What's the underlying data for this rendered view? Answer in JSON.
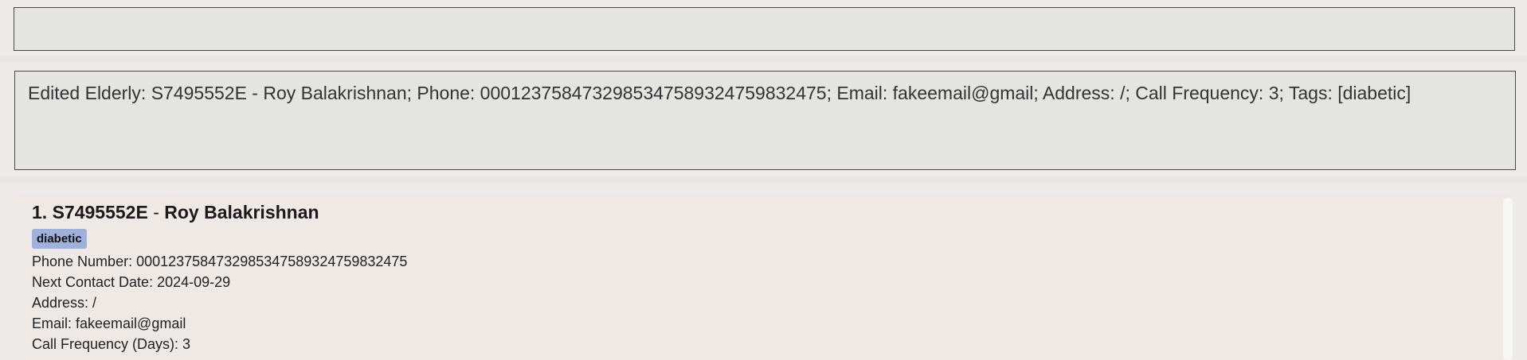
{
  "command_box": {
    "value": "",
    "placeholder": ""
  },
  "result_display": {
    "message": "Edited Elderly: S7495552E - Roy Balakrishnan; Phone: 0001237584732985347589324759832475; Email: fakeemail@gmail; Address: /; Call Frequency: 3; Tags: [diabetic]"
  },
  "person_list": {
    "cards": [
      {
        "index": "1.",
        "nric": "S7495552E",
        "separator": "-",
        "name": "Roy Balakrishnan",
        "tags": [
          "diabetic"
        ],
        "phone": "Phone Number: 0001237584732985347589324759832475",
        "next_contact": "Next Contact Date: 2024-09-29",
        "address": "Address: /",
        "email": "Email: fakeemail@gmail",
        "call_frequency": "Call Frequency (Days): 3"
      }
    ]
  },
  "colors": {
    "background": "#ecebea",
    "box_background": "#e4e4e3",
    "box_border": "#4a4a4a",
    "card_background": "#efe9e6",
    "tag_background": "#9fb0da"
  }
}
